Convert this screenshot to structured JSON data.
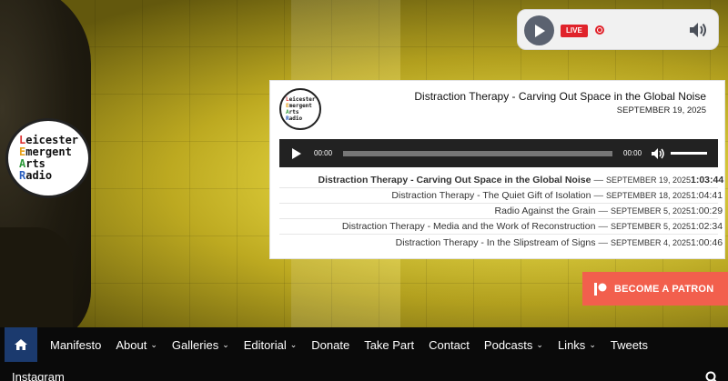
{
  "logo": {
    "lines": [
      {
        "initial": "L",
        "rest": "eicester"
      },
      {
        "initial": "E",
        "rest": "mergent"
      },
      {
        "initial": "A",
        "rest": "rts"
      },
      {
        "initial": "R",
        "rest": "adio"
      }
    ]
  },
  "live_player": {
    "badge": "LIVE",
    "play_icon": "play-icon",
    "volume_icon": "volume-icon"
  },
  "podcast": {
    "current_title": "Distraction Therapy - Carving Out Space in the Global Noise",
    "current_date": "SEPTEMBER 19, 2025",
    "audio": {
      "current_time": "00:00",
      "duration": "00:00"
    },
    "episodes": [
      {
        "title": "Distraction Therapy - Carving Out Space in the Global Noise",
        "date": "SEPTEMBER 19, 2025",
        "duration": "1:03:44"
      },
      {
        "title": "Distraction Therapy - The Quiet Gift of Isolation",
        "date": "SEPTEMBER 18, 2025",
        "duration": "1:04:41"
      },
      {
        "title": "Radio Against the Grain",
        "date": "SEPTEMBER 5, 2025",
        "duration": "1:00:29"
      },
      {
        "title": "Distraction Therapy - Media and the Work of Reconstruction",
        "date": "SEPTEMBER 5, 2025",
        "duration": "1:02:34"
      },
      {
        "title": "Distraction Therapy - In the Slipstream of Signs",
        "date": "SEPTEMBER 4, 2025",
        "duration": "1:00:46"
      }
    ],
    "separator": "—"
  },
  "patron": {
    "label": "BECOME A PATRON"
  },
  "nav": {
    "items": [
      {
        "label": "Manifesto",
        "dropdown": false
      },
      {
        "label": "About",
        "dropdown": true
      },
      {
        "label": "Galleries",
        "dropdown": true
      },
      {
        "label": "Editorial",
        "dropdown": true
      },
      {
        "label": "Donate",
        "dropdown": false
      },
      {
        "label": "Take Part",
        "dropdown": false
      },
      {
        "label": "Contact",
        "dropdown": false
      },
      {
        "label": "Podcasts",
        "dropdown": true
      },
      {
        "label": "Links",
        "dropdown": true
      },
      {
        "label": "Tweets",
        "dropdown": false
      }
    ],
    "row2": "Instagram"
  },
  "colors": {
    "nav_bg": "#0a0a0a",
    "home_bg": "#1b3a6e",
    "patron_bg": "#f25f4d",
    "live_red": "#e0232b"
  }
}
